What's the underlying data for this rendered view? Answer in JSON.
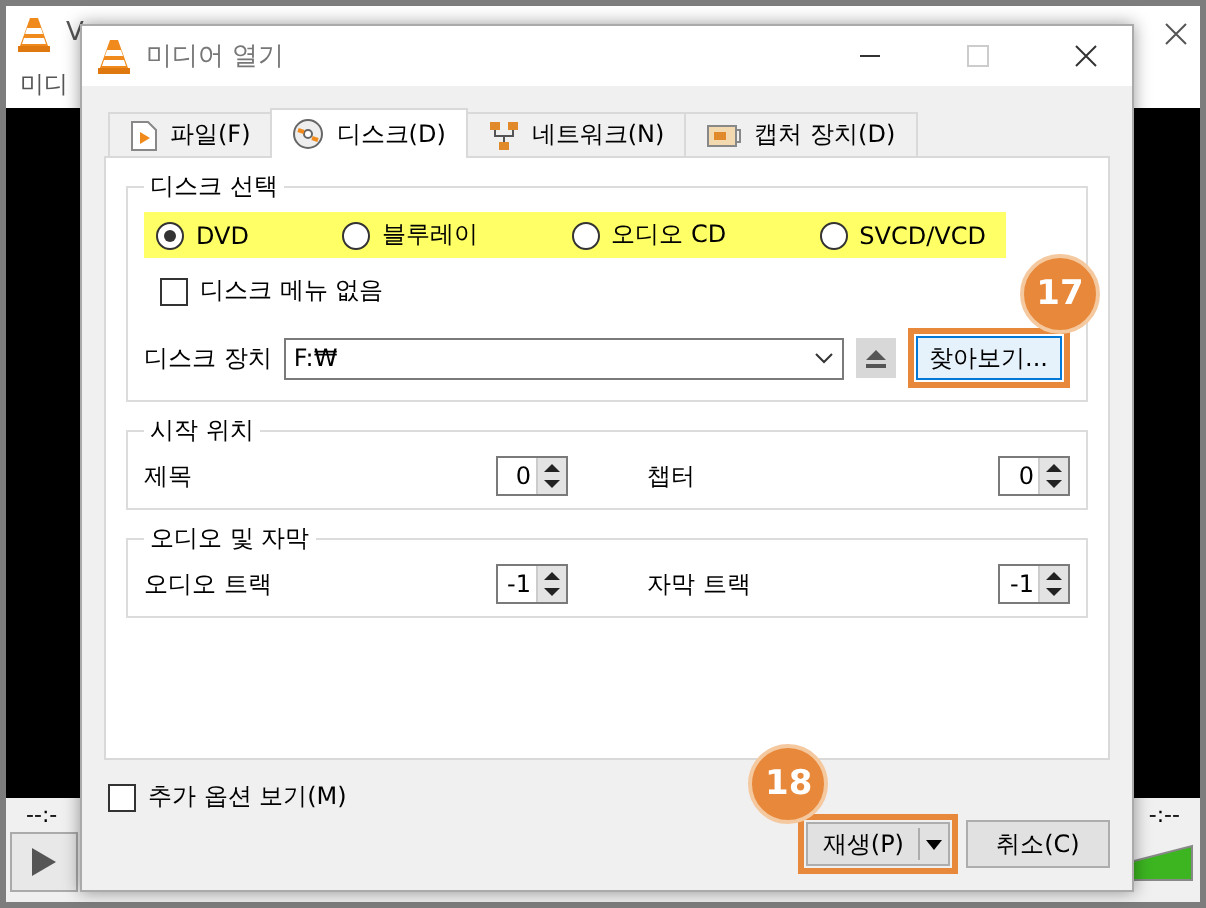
{
  "background_window": {
    "title": "V",
    "menu": [
      "미디"
    ],
    "time_elapsed": "--:-",
    "time_total": "-:--"
  },
  "dialog": {
    "title": "미디어 열기",
    "tabs": [
      {
        "label": "파일(F)",
        "kind": "file",
        "selected": false
      },
      {
        "label": "디스크(D)",
        "kind": "disc",
        "selected": true
      },
      {
        "label": "네트워크(N)",
        "kind": "network",
        "selected": false
      },
      {
        "label": "캡처 장치(D)",
        "kind": "capture",
        "selected": false
      }
    ],
    "disc_selection": {
      "title": "디스크 선택",
      "highlighted": true,
      "options": [
        {
          "label": "DVD",
          "selected": true
        },
        {
          "label": "블루레이",
          "selected": false
        },
        {
          "label": "오디오 CD",
          "selected": false
        },
        {
          "label": "SVCD/VCD",
          "selected": false
        }
      ],
      "no_disc_menu": {
        "label": "디스크 메뉴 없음",
        "checked": false
      },
      "device": {
        "label": "디스크 장치",
        "value": "F:₩"
      },
      "browse_button": {
        "label": "찾아보기...",
        "callout": "17"
      }
    },
    "start_position": {
      "title": "시작 위치",
      "fields": [
        {
          "label": "제목",
          "value": "0"
        },
        {
          "label": "챕터",
          "value": "0"
        }
      ]
    },
    "audio_subtitles": {
      "title": "오디오 및 자막",
      "fields": [
        {
          "label": "오디오 트랙",
          "value": "-1"
        },
        {
          "label": "자막 트랙",
          "value": "-1"
        }
      ]
    },
    "show_more_options": {
      "label": "추가 옵션 보기(M)",
      "checked": false
    },
    "play_button": {
      "label": "재생(P)",
      "callout": "18"
    },
    "cancel_button": {
      "label": "취소(C)"
    }
  }
}
